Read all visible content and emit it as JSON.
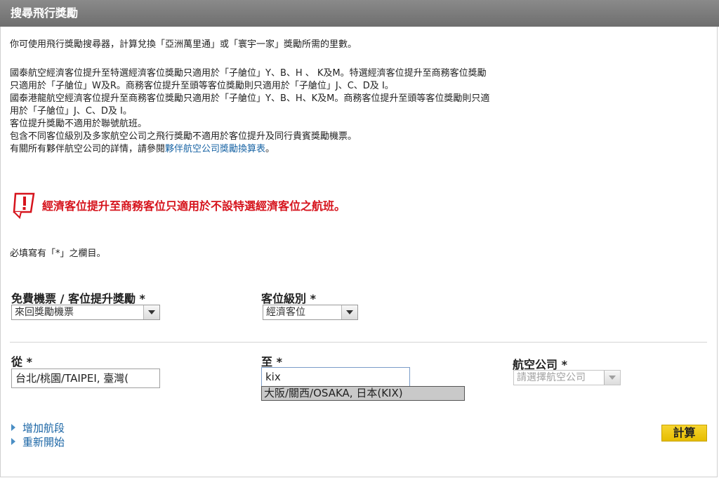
{
  "header": {
    "title": "搜尋飛行獎勵"
  },
  "intro": "你可使用飛行獎勵搜尋器，計算兌換「亞洲萬里通」或「寰宇一家」獎勵所需的里數。",
  "rules": [
    "國泰航空經濟客位提升至特選經濟客位獎勵只適用於「子艙位」Y、B、H 、 K及M。特選經濟客位提升至商務客位獎勵",
    "只適用於「子艙位」W及R。商務客位提升至頭等客位獎勵則只適用於「子艙位」J、C、D及 I。",
    "國泰港龍航空經濟客位提升至商務客位獎勵只適用於「子艙位」Y、B、H、K及M。商務客位提升至頭等客位獎勵則只適",
    "用於「子艙位」J、C、D及 I。",
    "客位提升獎勵不適用於聯號航班。",
    "包含不同客位級別及多家航空公司之飛行獎勵不適用於客位提升及同行貴賓獎勵機票。"
  ],
  "partner_line": {
    "prefix": "有關所有夥伴航空公司的詳情，請參閱",
    "link": "夥伴航空公司獎勵換算表",
    "suffix": "。"
  },
  "warning": {
    "text": "經濟客位提升至商務客位只適用於不設特選經濟客位之航班。",
    "icon": "warning-icon"
  },
  "required_note": "必填寫有「*」之欄目。",
  "form": {
    "award_type": {
      "label": "免費機票 / 客位提升獎勵 *",
      "value": "來回獎勵機票"
    },
    "cabin_class": {
      "label": "客位級別 *",
      "value": "經濟客位"
    },
    "from": {
      "label": "從 *",
      "value": "台北/桃園/TAIPEI, 臺灣("
    },
    "to": {
      "label": "至 *",
      "value": "kix",
      "suggestion": "大阪/關西/OSAKA, 日本(KIX)"
    },
    "airline": {
      "label": "航空公司 *",
      "placeholder": "請選擇航空公司"
    }
  },
  "actions": {
    "add_segment": "增加航段",
    "restart": "重新開始",
    "calculate": "計算"
  },
  "colors": {
    "warning": "#d6141d",
    "link": "#1a65a5",
    "button": "#f2cc1a"
  }
}
